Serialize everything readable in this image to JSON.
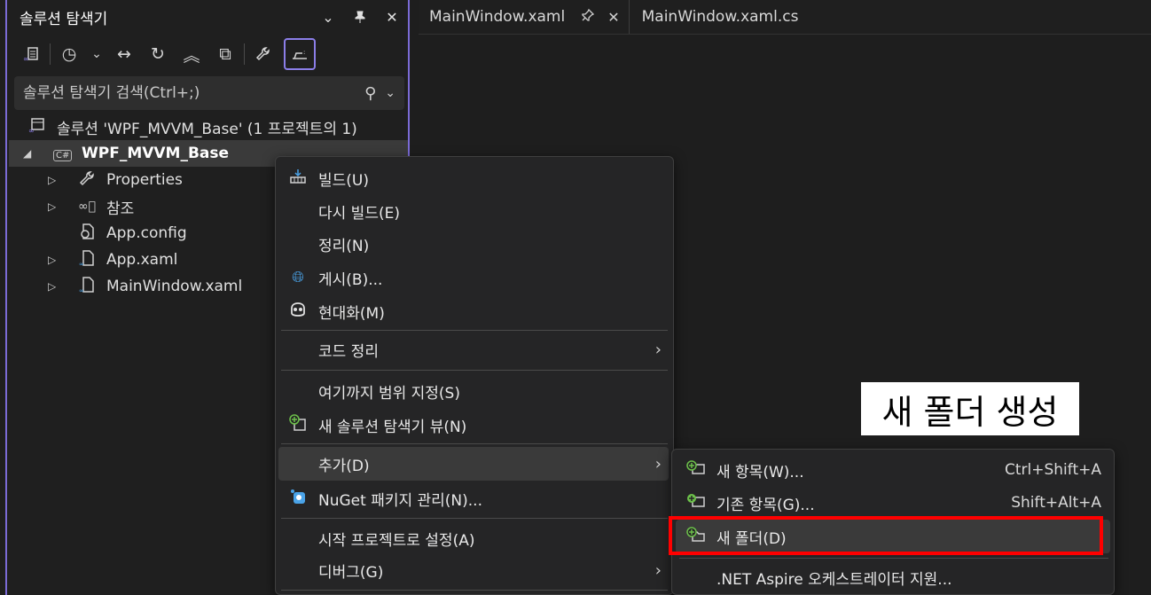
{
  "solution_explorer": {
    "title": "솔루션 탐색기",
    "search_placeholder": "솔루션 탐색기 검색(Ctrl+;)",
    "tree": [
      {
        "label": "솔루션 'WPF_MVVM_Base' (1 프로젝트의 1)",
        "icon": "solution-icon"
      },
      {
        "label": "WPF_MVVM_Base",
        "icon": "csharp-project-icon",
        "expanded": true,
        "selected": true
      },
      {
        "label": "Properties",
        "icon": "wrench-icon"
      },
      {
        "label": "참조",
        "icon": "references-icon"
      },
      {
        "label": "App.config",
        "icon": "config-file-icon"
      },
      {
        "label": "App.xaml",
        "icon": "xaml-file-icon"
      },
      {
        "label": "MainWindow.xaml",
        "icon": "xaml-file-icon"
      }
    ]
  },
  "tabs": [
    {
      "label": "MainWindow.xaml"
    },
    {
      "label": "MainWindow.xaml.cs"
    }
  ],
  "context_menu": [
    {
      "label": "빌드(U)",
      "icon": "build-icon"
    },
    {
      "label": "다시 빌드(E)"
    },
    {
      "label": "정리(N)"
    },
    {
      "label": "게시(B)...",
      "icon": "publish-globe-icon"
    },
    {
      "label": "현대화(M)",
      "icon": "copilot-icon"
    },
    {
      "label": "코드 정리",
      "submenu": true
    },
    {
      "label": "여기까지 범위 지정(S)"
    },
    {
      "label": "새 솔루션 탐색기 뷰(N)",
      "icon": "new-view-icon"
    },
    {
      "label": "추가(D)",
      "submenu": true,
      "highlighted": true
    },
    {
      "label": "NuGet 패키지 관리(N)...",
      "icon": "nuget-icon"
    },
    {
      "label": "시작 프로젝트로 설정(A)"
    },
    {
      "label": "디버그(G)",
      "submenu": true
    }
  ],
  "add_submenu": [
    {
      "label": "새 항목(W)...",
      "shortcut": "Ctrl+Shift+A",
      "icon": "new-item-icon"
    },
    {
      "label": "기존 항목(G)...",
      "shortcut": "Shift+Alt+A",
      "icon": "existing-item-icon"
    },
    {
      "label": "새 폴더(D)",
      "icon": "new-folder-icon",
      "highlighted": true
    },
    {
      "label": ".NET Aspire 오케스트레이터 지원..."
    }
  ],
  "annotation": "새 폴더 생성",
  "colors": {
    "accent": "#7b6bd6",
    "highlight_box": "#ff0000",
    "green_plus": "#6cc04a"
  }
}
